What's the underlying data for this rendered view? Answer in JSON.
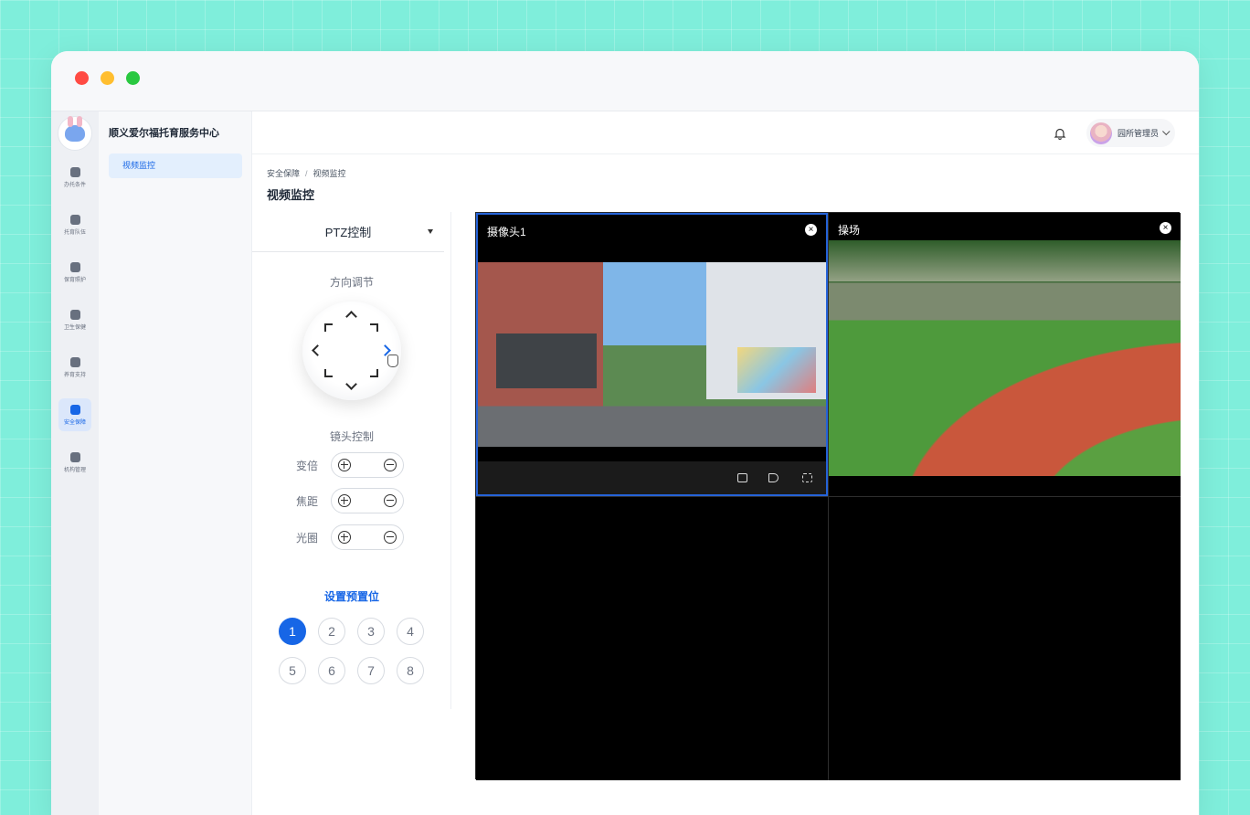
{
  "app": {
    "org_name": "顺义爱尔福托育服务中心"
  },
  "rail": {
    "items": [
      {
        "label": "办托条件",
        "icon": "building-icon"
      },
      {
        "label": "托育队伍",
        "icon": "team-icon"
      },
      {
        "label": "保育照护",
        "icon": "care-icon"
      },
      {
        "label": "卫生保健",
        "icon": "health-icon"
      },
      {
        "label": "养育支持",
        "icon": "support-icon"
      },
      {
        "label": "安全保障",
        "icon": "shield-icon"
      },
      {
        "label": "机构管理",
        "icon": "institution-icon"
      }
    ]
  },
  "submenu": {
    "active": "视频监控"
  },
  "topbar": {
    "user_name": "园所管理员"
  },
  "breadcrumb": {
    "parent": "安全保障",
    "sep": "/",
    "current": "视频监控"
  },
  "page": {
    "title": "视频监控"
  },
  "ptz": {
    "title": "PTZ控制",
    "direction_label": "方向调节",
    "lens_label": "镜头控制",
    "lens_rows": [
      "变倍",
      "焦距",
      "光圈"
    ],
    "preset_title": "设置预置位",
    "presets": [
      "1",
      "2",
      "3",
      "4",
      "5",
      "6",
      "7",
      "8"
    ],
    "active_preset": "1"
  },
  "cameras": [
    {
      "title": "摄像头1",
      "close": "×"
    },
    {
      "title": "操场",
      "close": "×"
    }
  ]
}
